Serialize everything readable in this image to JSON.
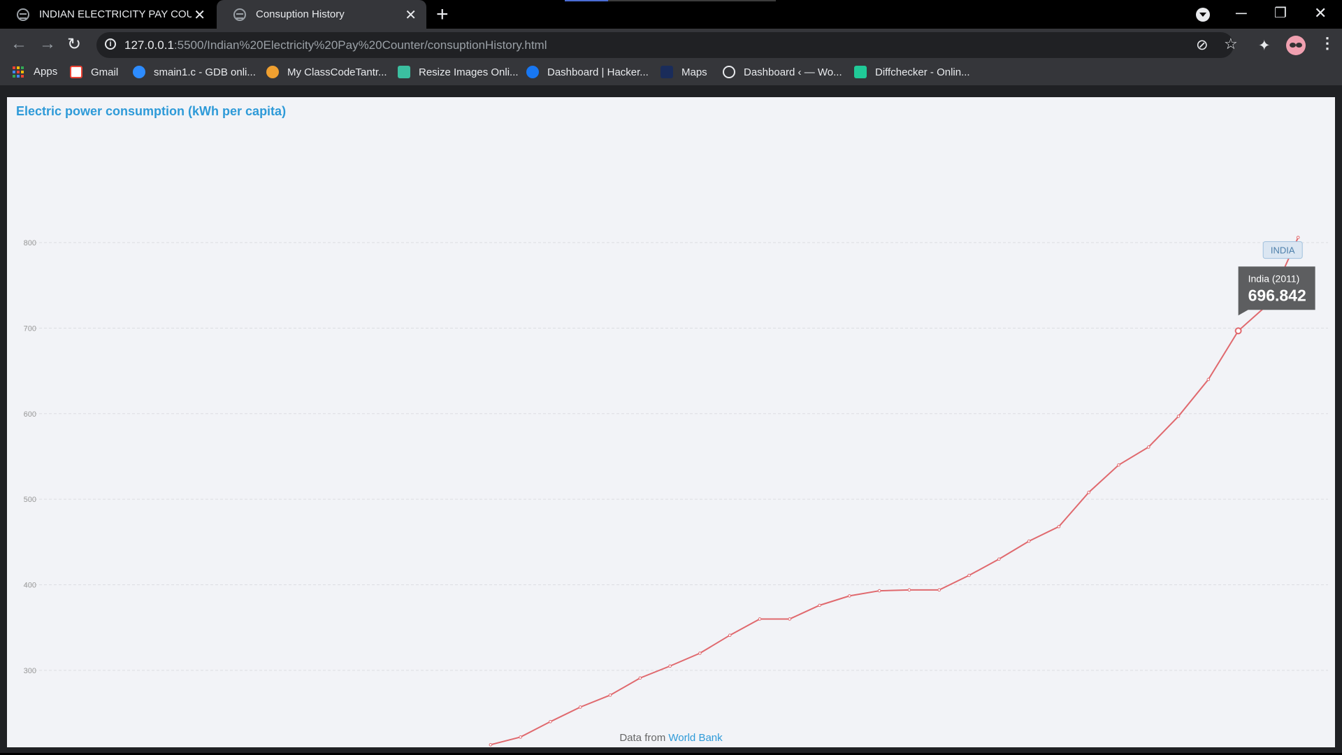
{
  "browser": {
    "tabs": [
      {
        "title": "INDIAN ELECTRICITY PAY COUNTER"
      },
      {
        "title": "Consuption History"
      }
    ],
    "url_host": "127.0.0.1",
    "url_rest": ":5500/Indian%20Electricity%20Pay%20Counter/consuptionHistory.html",
    "bookmarks": [
      {
        "label": "Apps",
        "icon": "apps-grid-icon"
      },
      {
        "label": "Gmail",
        "icon": "gmail-icon"
      },
      {
        "label": "smain1.c - GDB onli...",
        "icon": "gdb-icon"
      },
      {
        "label": "My ClassCodeTantr...",
        "icon": "classcode-icon"
      },
      {
        "label": "Resize Images Onli...",
        "icon": "resize-icon"
      },
      {
        "label": "Dashboard | Hacker...",
        "icon": "facebook-icon"
      },
      {
        "label": "Maps",
        "icon": "maps-icon"
      },
      {
        "label": "Dashboard ‹ — Wo...",
        "icon": "wordpress-icon"
      },
      {
        "label": "Diffchecker - Onlin...",
        "icon": "diffchecker-icon"
      }
    ]
  },
  "chart": {
    "title": "Electric power consumption (kWh per capita)",
    "credits_prefix": "Data from",
    "credits_link": "World Bank",
    "series_label": "INDIA",
    "tooltip": {
      "header": "India (2011)",
      "value": "696.842"
    }
  },
  "chart_data": {
    "type": "line",
    "title": "Electric power consumption (kWh per capita)",
    "yticks": [
      300,
      400,
      500,
      600,
      700,
      800
    ],
    "ylim": [
      210,
      970
    ],
    "xlim": [
      1971,
      2014
    ],
    "grid": true,
    "line_color": "#e0696e",
    "series": [
      {
        "name": "INDIA",
        "x": [
          1986,
          1987,
          1988,
          1989,
          1990,
          1991,
          1992,
          1993,
          1994,
          1995,
          1996,
          1997,
          1998,
          1999,
          2000,
          2001,
          2002,
          2003,
          2004,
          2005,
          2006,
          2007,
          2008,
          2009,
          2010,
          2011,
          2012,
          2013
        ],
        "values": [
          213,
          222,
          240,
          257,
          271,
          291,
          305,
          320,
          341,
          360,
          360,
          376,
          387,
          393,
          394,
          394,
          411,
          430,
          451,
          468,
          508,
          540,
          561,
          597,
          640,
          696.842,
          728,
          806
        ]
      }
    ],
    "highlight": {
      "x": 2011,
      "y": 696.842
    }
  }
}
